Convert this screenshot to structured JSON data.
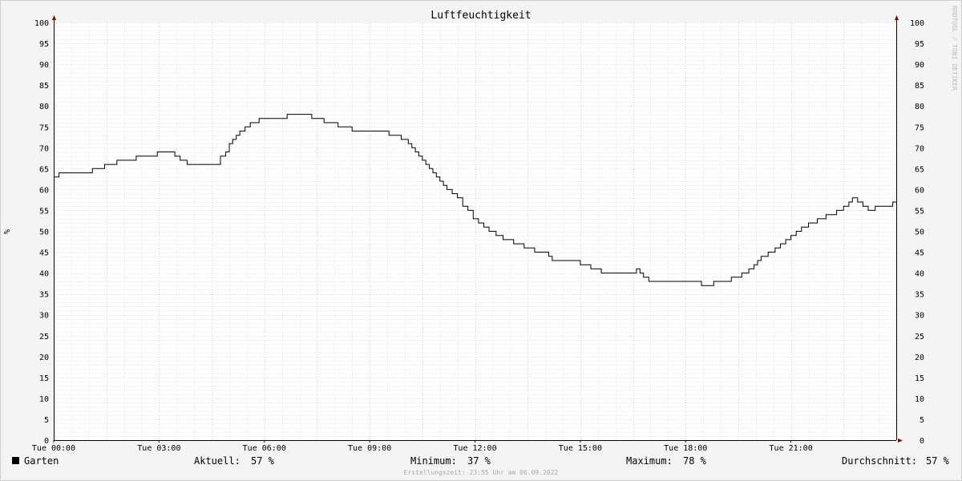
{
  "chart_data": {
    "type": "line",
    "title": "Luftfeuchtigkeit",
    "ylabel": "%",
    "ylabel_right": "%",
    "ylim": [
      0,
      100
    ],
    "yticks": [
      0,
      5,
      10,
      15,
      20,
      25,
      30,
      35,
      40,
      45,
      50,
      55,
      60,
      65,
      70,
      75,
      80,
      85,
      90,
      95,
      100
    ],
    "xlim_hours": [
      0,
      24
    ],
    "xticks": [
      {
        "h": 0,
        "label": "Tue 00:00"
      },
      {
        "h": 3,
        "label": "Tue 03:00"
      },
      {
        "h": 6,
        "label": "Tue 06:00"
      },
      {
        "h": 9,
        "label": "Tue 09:00"
      },
      {
        "h": 12,
        "label": "Tue 12:00"
      },
      {
        "h": 15,
        "label": "Tue 15:00"
      },
      {
        "h": 18,
        "label": "Tue 18:00"
      },
      {
        "h": 21,
        "label": "Tue 21:00"
      }
    ],
    "grid": true,
    "series": [
      {
        "name": "Garten",
        "color": "#000000",
        "x_hours": [
          0,
          0.15,
          1.1,
          1.45,
          1.8,
          2.35,
          2.95,
          3.45,
          3.6,
          3.8,
          4.6,
          4.75,
          4.9,
          5,
          5.1,
          5.2,
          5.3,
          5.45,
          5.6,
          5.85,
          6.15,
          6.65,
          7.35,
          7.7,
          8.1,
          8.5,
          9.3,
          9.55,
          9.9,
          10.1,
          10.2,
          10.3,
          10.4,
          10.5,
          10.6,
          10.7,
          10.8,
          10.9,
          11,
          11.1,
          11.2,
          11.35,
          11.5,
          11.65,
          11.8,
          11.95,
          12.1,
          12.25,
          12.4,
          12.6,
          12.8,
          13.1,
          13.4,
          13.7,
          14,
          14.1,
          14.2,
          15,
          15.3,
          15.6,
          15.9,
          16,
          16.1,
          16.3,
          16.45,
          16.6,
          16.7,
          16.8,
          16.95,
          17.15,
          18.45,
          18.8,
          19.3,
          19.6,
          19.8,
          19.95,
          20.05,
          20.15,
          20.35,
          20.55,
          20.7,
          20.85,
          21,
          21.15,
          21.3,
          21.5,
          21.75,
          22,
          22.3,
          22.5,
          22.65,
          22.75,
          22.9,
          23.05,
          23.2,
          23.4,
          23.6,
          23.9
        ],
        "values": [
          63,
          64,
          65,
          66,
          67,
          68,
          69,
          68,
          67,
          66,
          66,
          68,
          69,
          71,
          72,
          73,
          74,
          75,
          76,
          77,
          77,
          78,
          77,
          76,
          75,
          74,
          74,
          73,
          72,
          71,
          70,
          69,
          68,
          67,
          66,
          65,
          64,
          63,
          62,
          61,
          60,
          59,
          58,
          56,
          55,
          53,
          52,
          51,
          50,
          49,
          48,
          47,
          46,
          45,
          45,
          44,
          43,
          42,
          41,
          40,
          40,
          40,
          40,
          40,
          40,
          41,
          40,
          39,
          38,
          38,
          37,
          38,
          39,
          40,
          41,
          42,
          43,
          44,
          45,
          46,
          47,
          48,
          49,
          50,
          51,
          52,
          53,
          54,
          55,
          56,
          57,
          58,
          57,
          56,
          55,
          56,
          56,
          57
        ]
      }
    ]
  },
  "watermark": "RRDTOOL / TOBI OETIKER",
  "legend": {
    "series_name": "Garten",
    "swatch_color": "#000000",
    "current_label": "Aktuell:",
    "current_value": "57 %",
    "min_label": "Minimum:",
    "min_value": "37 %",
    "max_label": "Maximum:",
    "max_value": "78 %",
    "avg_label": "Durchschnitt:",
    "avg_value": "57 %"
  },
  "footer": "Erstellungszeit: 23:55 Uhr am 06.09.2022",
  "colors": {
    "background": "#f4f4f4",
    "plot_background": "#ffffff",
    "minor_grid": "#d8d8d8",
    "major_grid": "#e8a0a0",
    "axis_arrow": "#8b0000"
  }
}
